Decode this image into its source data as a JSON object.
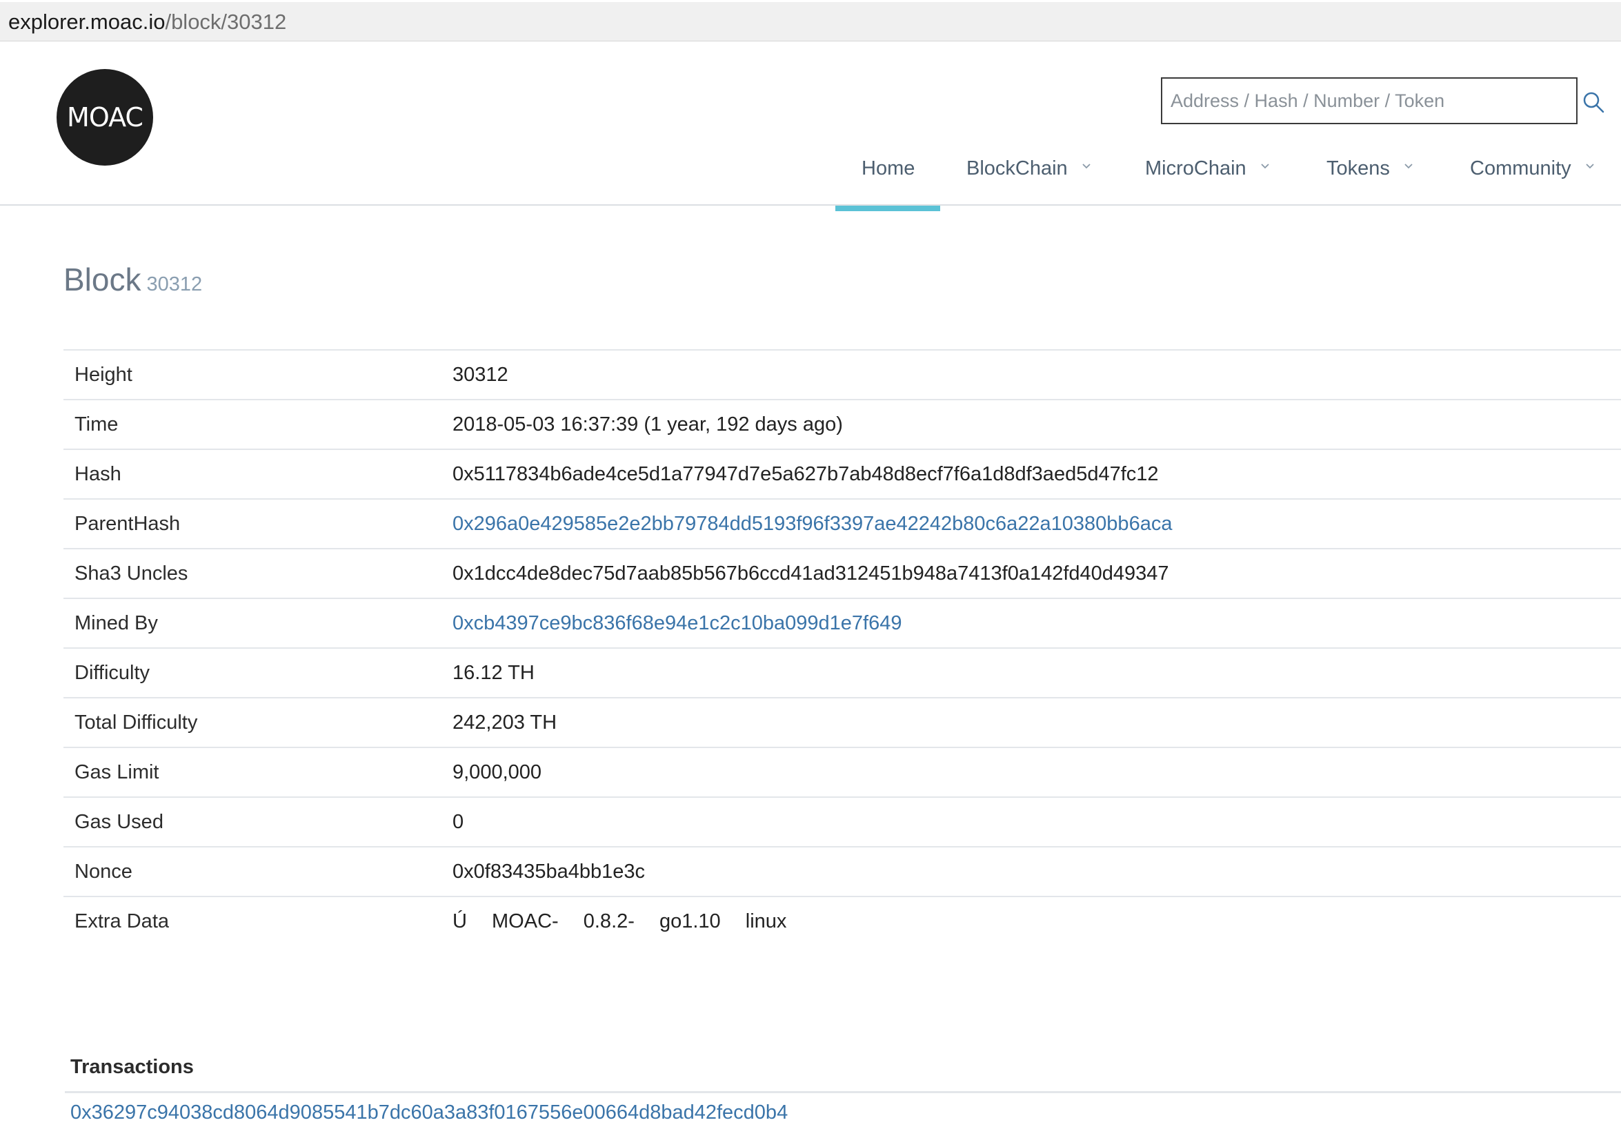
{
  "browser": {
    "url_host": "explorer.moac.io",
    "url_path": "/block/30312"
  },
  "header": {
    "logo_text": "MOAC",
    "search_placeholder": "Address / Hash / Number / Token",
    "nav": [
      {
        "label": "Home",
        "active": true
      },
      {
        "label": "BlockChain",
        "dropdown": true
      },
      {
        "label": "MicroChain",
        "dropdown": true
      },
      {
        "label": "Tokens",
        "dropdown": true
      },
      {
        "label": "Community",
        "dropdown": true
      }
    ],
    "accent_color": "#5bc2d6"
  },
  "page": {
    "title": "Block",
    "block_number": "30312"
  },
  "details": {
    "height": {
      "label": "Height",
      "value": "30312"
    },
    "time": {
      "label": "Time",
      "value": "2018-05-03 16:37:39 (1 year, 192 days ago)"
    },
    "hash": {
      "label": "Hash",
      "value": "0x5117834b6ade4ce5d1a77947d7e5a627b7ab48d8ecf7f6a1d8df3aed5d47fc12"
    },
    "parent_hash": {
      "label": "ParentHash",
      "value": "0x296a0e429585e2e2bb79784dd5193f96f3397ae42242b80c6a22a10380bb6aca"
    },
    "sha3_uncles": {
      "label": "Sha3 Uncles",
      "value": "0x1dcc4de8dec75d7aab85b567b6ccd41ad312451b948a7413f0a142fd40d49347"
    },
    "mined_by": {
      "label": "Mined By",
      "value": "0xcb4397ce9bc836f68e94e1c2c10ba099d1e7f649"
    },
    "difficulty": {
      "label": "Difficulty",
      "value": "16.12 TH"
    },
    "total_difficulty": {
      "label": "Total Difficulty",
      "value": "242,203 TH"
    },
    "gas_limit": {
      "label": "Gas Limit",
      "value": "9,000,000"
    },
    "gas_used": {
      "label": "Gas Used",
      "value": "0"
    },
    "nonce": {
      "label": "Nonce",
      "value": "0x0f83435ba4bb1e3c"
    },
    "extra_data": {
      "label": "Extra Data",
      "parts": [
        "Ú",
        "MOAC-",
        "0.8.2-",
        "go1.10",
        "linux"
      ]
    }
  },
  "transactions": {
    "title": "Transactions",
    "items": [
      "0x36297c94038cd8064d9085541b7dc60a3a83f0167556e00664d8bad42fecd0b4"
    ]
  },
  "colors": {
    "link": "#3a74a9",
    "nav_text": "#4c5e6f",
    "title_gray": "#6b7887"
  }
}
